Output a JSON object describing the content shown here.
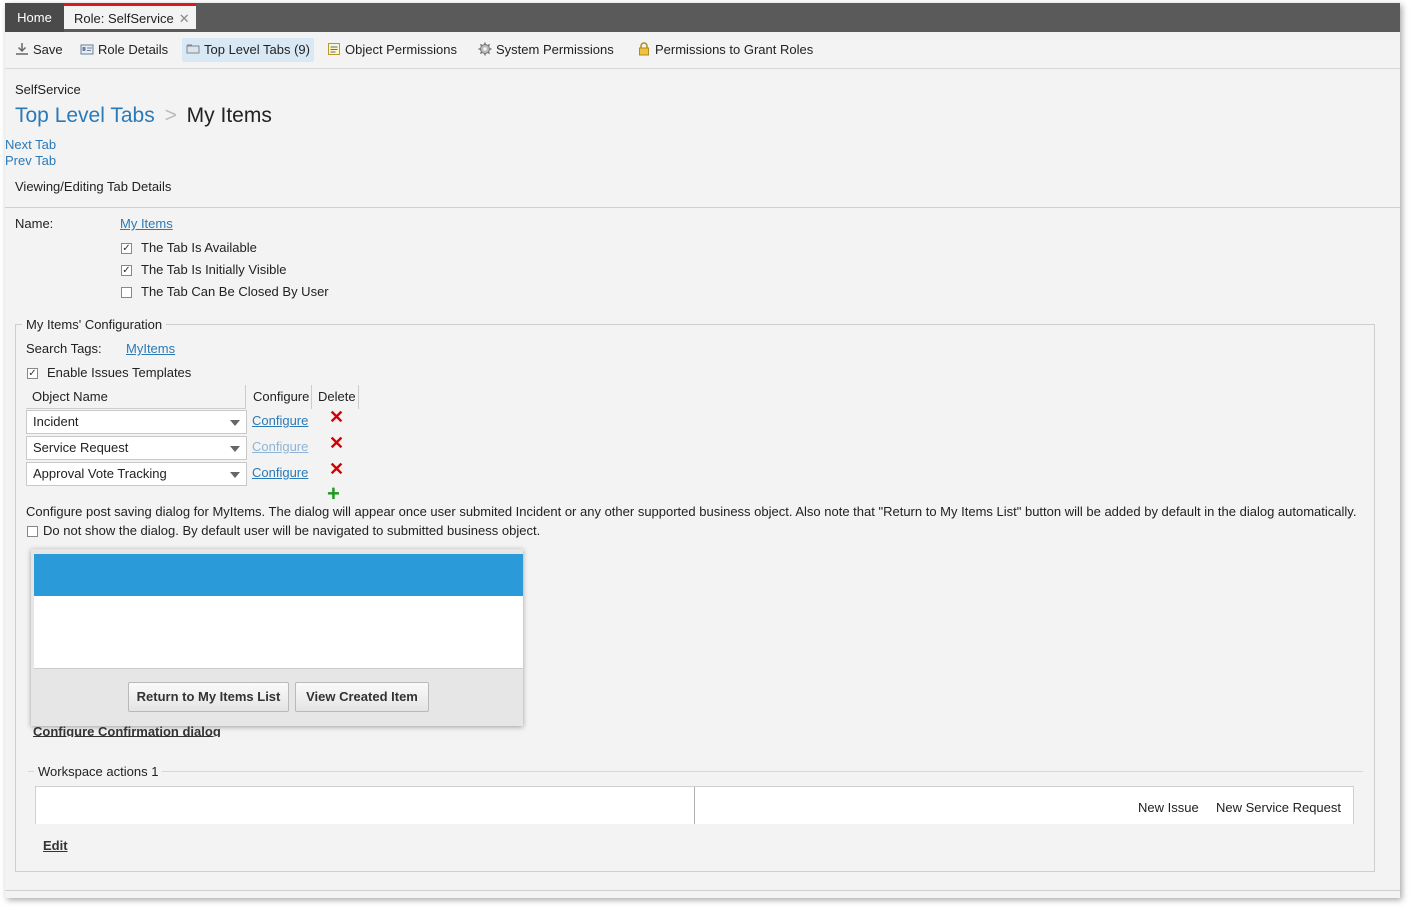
{
  "tabs": [
    {
      "label": "Home"
    },
    {
      "label": "Role: SelfService"
    }
  ],
  "toolbar": {
    "save": "Save",
    "role_details": "Role Details",
    "top_level_tabs": "Top Level Tabs (9)",
    "object_permissions": "Object Permissions",
    "system_permissions": "System Permissions",
    "grant_roles": "Permissions to Grant Roles"
  },
  "header": {
    "role_name": "SelfService",
    "breadcrumb_parent": "Top Level Tabs",
    "breadcrumb_sep": ">",
    "breadcrumb_current": "My Items",
    "next_tab": "Next Tab",
    "prev_tab": "Prev Tab",
    "section_title": "Viewing/Editing Tab Details"
  },
  "details": {
    "name_label": "Name:",
    "name_value": "My Items",
    "checks": [
      {
        "label": "The Tab Is Available",
        "checked": true
      },
      {
        "label": "The Tab Is Initially Visible",
        "checked": true
      },
      {
        "label": "The Tab Can Be Closed By User",
        "checked": false
      }
    ]
  },
  "config": {
    "legend": "My Items' Configuration",
    "search_tags_label": "Search Tags:",
    "search_tags_value": "MyItems",
    "enable_templates": "Enable Issues Templates",
    "columns": [
      "Object Name",
      "Configure",
      "Delete"
    ],
    "rows": [
      {
        "object": "Incident",
        "configure": "Configure"
      },
      {
        "object": "Service Request",
        "configure": "Configure"
      },
      {
        "object": "Approval Vote Tracking",
        "configure": "Configure"
      }
    ],
    "post_saving_note": "Configure post saving dialog for MyItems. The dialog will appear once user submited Incident or any other supported business object. Also note that \"Return to My Items List\" button will be added by default in the dialog automatically.",
    "no_dialog": "Do not show the dialog. By default user will be navigated to submitted business object."
  },
  "dialog": {
    "btn_return": "Return to My Items List",
    "btn_view": "View Created Item",
    "configure_link": "Configure Confirmation dialog"
  },
  "workspace": {
    "legend": "Workspace actions 1",
    "actions": [
      "New Issue",
      "New Service Request"
    ],
    "edit": "Edit"
  },
  "colors": {
    "accent_blue": "#2b9ad8",
    "link_blue": "#2a7ab8",
    "active_tab_red": "#d71920",
    "delete_red": "#d40000",
    "add_green": "#1a9a1a"
  }
}
